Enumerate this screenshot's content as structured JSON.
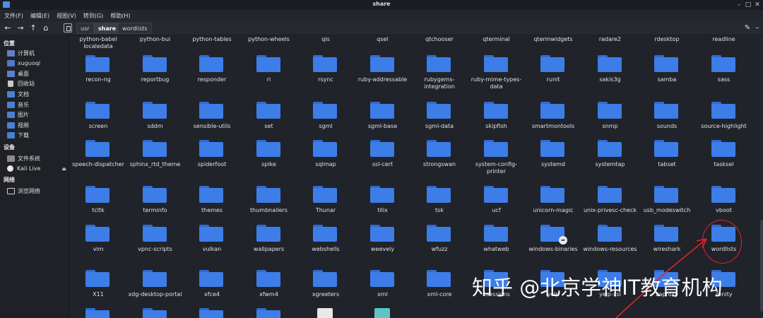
{
  "window": {
    "title": "share"
  },
  "menu": [
    "文件(F)",
    "编辑(E)",
    "视图(V)",
    "转到(G)",
    "帮助(H)"
  ],
  "breadcrumb": [
    {
      "label": "usr",
      "active": false
    },
    {
      "label": "share",
      "active": true
    },
    {
      "label": "wordlists",
      "active": false
    }
  ],
  "sidebar": {
    "places_title": "位置",
    "places": [
      {
        "label": "计算机",
        "icon": "computer-icon"
      },
      {
        "label": "xuguoqi",
        "icon": "home-folder-icon"
      },
      {
        "label": "桌面",
        "icon": "desktop-icon"
      },
      {
        "label": "回收站",
        "icon": "trash-icon"
      },
      {
        "label": "文档",
        "icon": "documents-icon"
      },
      {
        "label": "音乐",
        "icon": "music-icon"
      },
      {
        "label": "图片",
        "icon": "pictures-icon"
      },
      {
        "label": "视频",
        "icon": "videos-icon"
      },
      {
        "label": "下载",
        "icon": "downloads-icon"
      }
    ],
    "devices_title": "设备",
    "devices": [
      {
        "label": "文件系统",
        "icon": "filesystem-icon"
      },
      {
        "label": "Kali Live",
        "icon": "disc-icon"
      }
    ],
    "network_title": "网络",
    "network": [
      {
        "label": "浏览网络",
        "icon": "network-icon"
      }
    ]
  },
  "files": {
    "row0_partial": [
      "python-babel\nlocaledata",
      "python-bui",
      "python-tables",
      "python-wheels",
      "qis",
      "qsel",
      "qtchooser",
      "qterminal",
      "qtermwidgets",
      "radare2",
      "rdesktop",
      "readline"
    ],
    "rows": [
      [
        "recon-ng",
        "reportbug",
        "responder",
        "ri",
        "rsync",
        "ruby-addressable",
        "rubygems-\nintegration",
        "ruby-mime-types-\ndata",
        "runit",
        "sakis3g",
        "samba",
        "sass"
      ],
      [
        "screen",
        "sddm",
        "sensible-utils",
        "set",
        "sgml",
        "sgml-base",
        "sgml-data",
        "skipfish",
        "smartmontools",
        "snmp",
        "sounds",
        "source-highlight"
      ],
      [
        "speech-dispatcher",
        "sphinx_rtd_theme",
        "spiderfoot",
        "spike",
        "sqlmap",
        "ssl-cert",
        "strongswan",
        "system-config-\nprinter",
        "systemd",
        "systemtap",
        "tabset",
        "tasksel"
      ],
      [
        "tcltk",
        "terminfo",
        "themes",
        "thumbnailers",
        "Thunar",
        "tilix",
        "tsk",
        "ucf",
        "unicorn-magic",
        "unix-privesc-check",
        "usb_modeswitch",
        "vboot"
      ],
      [
        "vim",
        "vpnc-scripts",
        "vulkan",
        "wallpapers",
        "webshells",
        "weevely",
        "wfuzz",
        "whatweb",
        "windows-binaries",
        "windows-resources",
        "wireshark",
        "wordlists"
      ],
      [
        "X11",
        "xdg-desktop-portal",
        "xfce4",
        "xfwm4",
        "xgreeters",
        "xml",
        "xml-core",
        "xsessions",
        "yelp",
        "yelp-xsl",
        "zaproxy",
        "zenity"
      ]
    ]
  },
  "watermark": "知乎 @北京学神IT教育机构",
  "colors": {
    "folder": "#3d7de8",
    "annotation": "#e0242a"
  }
}
